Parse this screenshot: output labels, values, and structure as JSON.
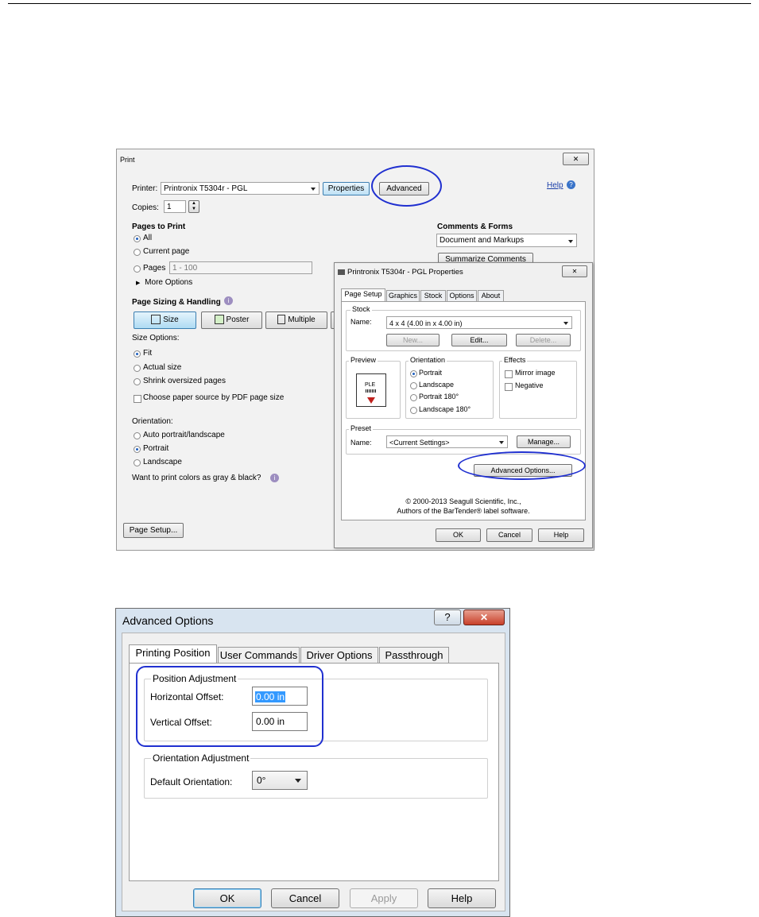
{
  "print": {
    "title": "Print",
    "close": "✕",
    "printer_label": "Printer:",
    "printer_value": "Printronix T5304r - PGL",
    "properties_btn": "Properties",
    "advanced_btn": "Advanced",
    "help_link": "Help",
    "copies_label": "Copies:",
    "copies_value": "1",
    "pages_heading": "Pages to Print",
    "pages_all": "All",
    "pages_current": "Current page",
    "pages_pages": "Pages",
    "pages_range": "1 - 100",
    "more_options": "More Options",
    "sizing_heading": "Page Sizing & Handling",
    "tab_size": "Size",
    "tab_poster": "Poster",
    "tab_multiple": "Multiple",
    "size_options": "Size Options:",
    "fit": "Fit",
    "actual": "Actual size",
    "shrink": "Shrink oversized pages",
    "choose_source": "Choose paper source by PDF page size",
    "orientation": "Orientation:",
    "auto": "Auto portrait/landscape",
    "portrait": "Portrait",
    "landscape": "Landscape",
    "gray": "Want to print colors as gray & black?",
    "page_setup_btn": "Page Setup...",
    "comments_heading": "Comments & Forms",
    "comments_value": "Document and Markups",
    "summarize_btn": "Summarize Comments"
  },
  "props": {
    "title": "Printronix T5304r - PGL Properties",
    "close": "✕",
    "tabs": [
      "Page Setup",
      "Graphics",
      "Stock",
      "Options",
      "About"
    ],
    "stock_legend": "Stock",
    "name_label": "Name:",
    "stock_value": "4 x 4 (4.00 in x 4.00 in)",
    "new_btn": "New...",
    "edit_btn": "Edit...",
    "delete_btn": "Delete...",
    "preview_legend": "Preview",
    "preview_text": "PLE",
    "orientation_legend": "Orientation",
    "o_portrait": "Portrait",
    "o_landscape": "Landscape",
    "o_portrait180": "Portrait 180°",
    "o_landscape180": "Landscape 180°",
    "effects_legend": "Effects",
    "mirror": "Mirror image",
    "negative": "Negative",
    "preset_legend": "Preset",
    "preset_value": "<Current Settings>",
    "manage_btn": "Manage...",
    "adv_options_btn": "Advanced Options...",
    "copyright1": "© 2000-2013 Seagull Scientific, Inc.,",
    "copyright2": "Authors of the BarTender® label software.",
    "ok": "OK",
    "cancel": "Cancel",
    "help": "Help"
  },
  "adv": {
    "title": "Advanced Options",
    "help_icon": "?",
    "close": "✕",
    "tabs": [
      "Printing Position",
      "User Commands",
      "Driver Options",
      "Passthrough"
    ],
    "pos_legend": "Position Adjustment",
    "h_offset_label": "Horizontal Offset:",
    "h_offset_value": "0.00 in",
    "v_offset_label": "Vertical Offset:",
    "v_offset_value": "0.00 in",
    "orient_legend": "Orientation Adjustment",
    "default_orient_label": "Default Orientation:",
    "default_orient_value": "0°",
    "ok": "OK",
    "cancel": "Cancel",
    "apply": "Apply",
    "help": "Help"
  }
}
